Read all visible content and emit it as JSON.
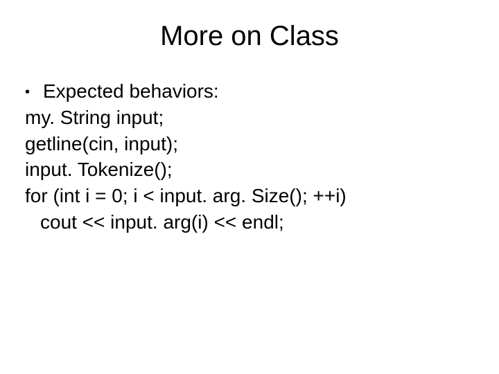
{
  "title": "More on Class",
  "bullet": "•",
  "lines": {
    "l0": "Expected behaviors:",
    "l1": "my. String input;",
    "l2": "getline(cin, input);",
    "l3": "input. Tokenize();",
    "l4": "for (int i = 0; i < input. arg. Size(); ++i)",
    "l5": "cout << input. arg(i) << endl;"
  }
}
